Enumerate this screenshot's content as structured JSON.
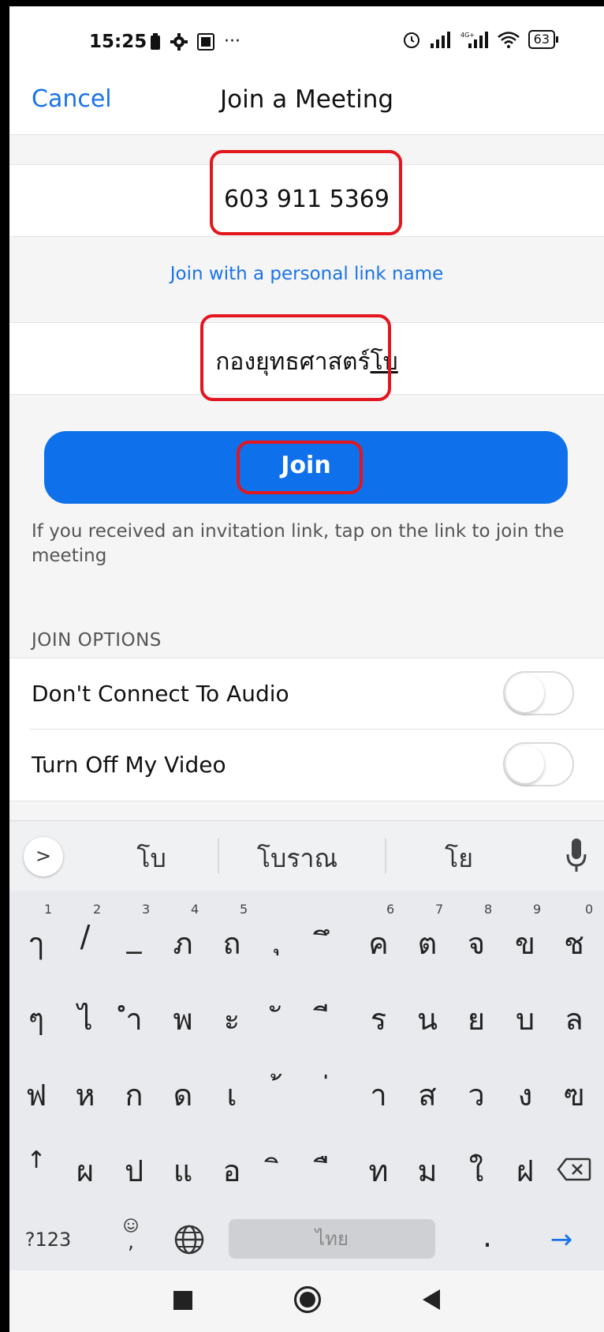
{
  "status_bar": {
    "time": "15:25",
    "left_icons": [
      "battery-saver-icon",
      "gear-icon",
      "app-icon",
      "more-icon"
    ],
    "more": "···",
    "right_icons": [
      "alarm-icon",
      "signal-icon",
      "signal-4g-icon",
      "wifi-icon"
    ],
    "battery": "63"
  },
  "header": {
    "cancel_label": "Cancel",
    "title": "Join a Meeting"
  },
  "meeting_id": {
    "value": "603 911 5369"
  },
  "personal_link_label": "Join with a personal link name",
  "name_field": {
    "value": "กองยุทธศาสตร์",
    "composing": "โบ"
  },
  "join_button_label": "Join",
  "hint": "If you received an invitation link, tap on the link to join the meeting",
  "join_options": {
    "section_label": "JOIN OPTIONS",
    "options": [
      {
        "label": "Don't Connect To Audio",
        "on": false
      },
      {
        "label": "Turn Off My Video",
        "on": false
      }
    ]
  },
  "keyboard": {
    "suggestions": [
      "โบ",
      "โบราณ",
      "โย"
    ],
    "row1": [
      "ๅ",
      "/",
      "_",
      "ภ",
      "ถ",
      "ุ",
      "ึ",
      "ค",
      "ต",
      "จ",
      "ข",
      "ช"
    ],
    "row1_nums": [
      "1",
      "2",
      "3",
      "4",
      "5",
      "6",
      "7",
      "8",
      "9",
      "0"
    ],
    "row2": [
      "ๆ",
      "ไ",
      "ำ",
      "พ",
      "ะ",
      "ั",
      "ี",
      "ร",
      "น",
      "ย",
      "บ",
      "ล"
    ],
    "row3": [
      "ฟ",
      "ห",
      "ก",
      "ด",
      "เ",
      "้",
      "่",
      "า",
      "ส",
      "ว",
      "ง",
      "ฃ"
    ],
    "row4": [
      "ผ",
      "ป",
      "แ",
      "อ",
      "ิ",
      "ื",
      "ท",
      "ม",
      "ใ",
      "ฝ"
    ],
    "shift": "↑",
    "symbols_label": "?123",
    "emoji_comma": ",",
    "space_label": "ไทย",
    "period": ".",
    "enter": "→"
  }
}
